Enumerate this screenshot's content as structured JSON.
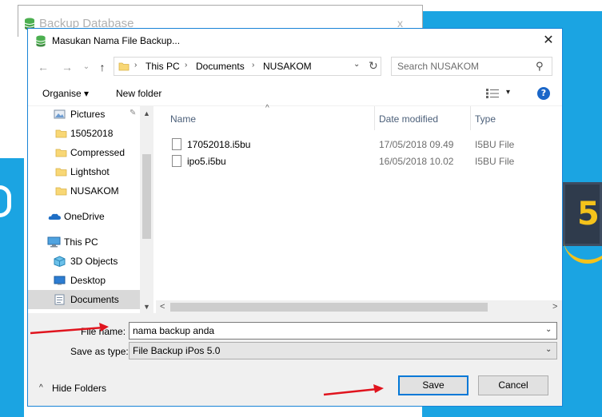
{
  "background_window": {
    "title": "Backup Database",
    "close": "x"
  },
  "dialog": {
    "title": "Masukan Nama File Backup...",
    "close_glyph": "✕"
  },
  "nav": {
    "back": "←",
    "forward": "→",
    "recent": "⌄",
    "up": "↑",
    "breadcrumb": [
      "This PC",
      "Documents",
      "NUSAKOM"
    ],
    "separator": "›",
    "dropdown": "⌄",
    "refresh": "↻",
    "search_placeholder": "Search NUSAKOM",
    "search_icon": "⚲"
  },
  "toolbar": {
    "organise_label": "Organise ▾",
    "new_folder_label": "New folder",
    "view_dropdown": "▾",
    "help": "?"
  },
  "sidebar": {
    "items": [
      {
        "label": "Pictures",
        "icon": "pictures-icon"
      },
      {
        "label": "15052018",
        "icon": "folder-icon"
      },
      {
        "label": "Compressed",
        "icon": "folder-icon"
      },
      {
        "label": "Lightshot",
        "icon": "folder-icon"
      },
      {
        "label": "NUSAKOM",
        "icon": "folder-icon"
      },
      {
        "label": "OneDrive",
        "icon": "cloud-icon"
      },
      {
        "label": "This PC",
        "icon": "computer-icon"
      },
      {
        "label": "3D Objects",
        "icon": "cube-icon"
      },
      {
        "label": "Desktop",
        "icon": "desktop-icon"
      },
      {
        "label": "Documents",
        "icon": "documents-icon"
      }
    ],
    "pin": "✎",
    "scroll_up": "▲",
    "scroll_down": "▼"
  },
  "files": {
    "columns": {
      "name": "Name",
      "date": "Date modified",
      "type": "Type"
    },
    "sort_glyph": "^",
    "rows": [
      {
        "name": "17052018.i5bu",
        "date": "17/05/2018 09.49",
        "type": "I5BU File"
      },
      {
        "name": "ipo5.i5bu",
        "date": "16/05/2018 10.02",
        "type": "I5BU File"
      }
    ],
    "scroll_left": "<",
    "scroll_right": ">"
  },
  "form": {
    "file_name_label": "File name:",
    "file_name_value": "nama backup anda",
    "save_as_label": "Save as type:",
    "save_as_value": "File Backup iPos 5.0",
    "dropdown": "⌄"
  },
  "footer": {
    "hide_folders_toggle": "^",
    "hide_folders_label": "Hide Folders",
    "save_label": "Save",
    "cancel_label": "Cancel"
  },
  "colors": {
    "accent": "#0078d7",
    "annotation": "#e0141e",
    "background_app": "#1ba4e2"
  }
}
